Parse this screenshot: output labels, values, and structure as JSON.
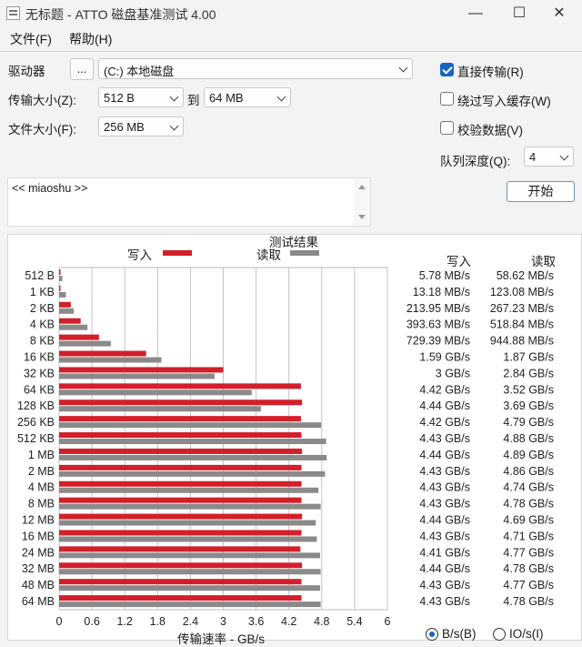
{
  "window": {
    "title": "无标题 - ATTO 磁盘基准测试 4.00",
    "minimize": "—",
    "maximize": "☐",
    "close": "✕"
  },
  "menu": {
    "file": "文件(F)",
    "help": "帮助(H)"
  },
  "drive": {
    "label": "驱动器",
    "browse": "...",
    "value": "(C:) 本地磁盘"
  },
  "transfer_size": {
    "label": "传输大小(Z):",
    "from": "512 B",
    "to_label": "到",
    "to": "64 MB"
  },
  "file_size": {
    "label": "文件大小(F):",
    "value": "256 MB"
  },
  "options": {
    "direct_io": {
      "label": "直接传输(R)",
      "checked": true
    },
    "bypass_cache": {
      "label": "绕过写入缓存(W)",
      "checked": false
    },
    "verify": {
      "label": "校验数据(V)",
      "checked": false
    },
    "queue_depth_label": "队列深度(Q):",
    "queue_depth": "4",
    "start": "开始"
  },
  "description": "<< miaoshu >>",
  "results": {
    "title": "测试结果",
    "legend_write": "写入",
    "legend_read": "读取",
    "col_write": "写入",
    "col_read": "读取",
    "xlabel": "传输速率 - GB/s",
    "units_bs": "B/s(B)",
    "units_ios": "IO/s(I)",
    "units_selected": "B/s(B)",
    "rows": [
      {
        "size": "512 B",
        "write": "5.78 MB/s",
        "read": "58.62 MB/s"
      },
      {
        "size": "1 KB",
        "write": "13.18 MB/s",
        "read": "123.08 MB/s"
      },
      {
        "size": "2 KB",
        "write": "213.95 MB/s",
        "read": "267.23 MB/s"
      },
      {
        "size": "4 KB",
        "write": "393.63 MB/s",
        "read": "518.84 MB/s"
      },
      {
        "size": "8 KB",
        "write": "729.39 MB/s",
        "read": "944.88 MB/s"
      },
      {
        "size": "16 KB",
        "write": "1.59 GB/s",
        "read": "1.87 GB/s"
      },
      {
        "size": "32 KB",
        "write": "3 GB/s",
        "read": "2.84 GB/s"
      },
      {
        "size": "64 KB",
        "write": "4.42 GB/s",
        "read": "3.52 GB/s"
      },
      {
        "size": "128 KB",
        "write": "4.44 GB/s",
        "read": "3.69 GB/s"
      },
      {
        "size": "256 KB",
        "write": "4.42 GB/s",
        "read": "4.79 GB/s"
      },
      {
        "size": "512 KB",
        "write": "4.43 GB/s",
        "read": "4.88 GB/s"
      },
      {
        "size": "1 MB",
        "write": "4.44 GB/s",
        "read": "4.89 GB/s"
      },
      {
        "size": "2 MB",
        "write": "4.43 GB/s",
        "read": "4.86 GB/s"
      },
      {
        "size": "4 MB",
        "write": "4.43 GB/s",
        "read": "4.74 GB/s"
      },
      {
        "size": "8 MB",
        "write": "4.43 GB/s",
        "read": "4.78 GB/s"
      },
      {
        "size": "12 MB",
        "write": "4.44 GB/s",
        "read": "4.69 GB/s"
      },
      {
        "size": "16 MB",
        "write": "4.43 GB/s",
        "read": "4.71 GB/s"
      },
      {
        "size": "24 MB",
        "write": "4.41 GB/s",
        "read": "4.77 GB/s"
      },
      {
        "size": "32 MB",
        "write": "4.44 GB/s",
        "read": "4.78 GB/s"
      },
      {
        "size": "48 MB",
        "write": "4.43 GB/s",
        "read": "4.77 GB/s"
      },
      {
        "size": "64 MB",
        "write": "4.43 GB/s",
        "read": "4.78 GB/s"
      }
    ]
  },
  "colors": {
    "write": "#d21f2a",
    "read": "#8a8a8a",
    "accent": "#1565c0"
  },
  "chart_data": {
    "type": "bar",
    "orientation": "horizontal",
    "title": "测试结果",
    "xlabel": "传输速率 - GB/s",
    "xlim": [
      0,
      6
    ],
    "xticks": [
      "0",
      "0.6",
      "1.2",
      "1.8",
      "2.4",
      "3",
      "3.6",
      "4.2",
      "4.8",
      "5.4",
      "6"
    ],
    "grid": true,
    "legend_placement": "top",
    "categories": [
      "512 B",
      "1 KB",
      "2 KB",
      "4 KB",
      "8 KB",
      "16 KB",
      "32 KB",
      "64 KB",
      "128 KB",
      "256 KB",
      "512 KB",
      "1 MB",
      "2 MB",
      "4 MB",
      "8 MB",
      "12 MB",
      "16 MB",
      "24 MB",
      "32 MB",
      "48 MB",
      "64 MB"
    ],
    "series": [
      {
        "name": "写入",
        "values": [
          0.00578,
          0.01318,
          0.21395,
          0.39363,
          0.72939,
          1.59,
          3.0,
          4.42,
          4.44,
          4.42,
          4.43,
          4.44,
          4.43,
          4.43,
          4.43,
          4.44,
          4.43,
          4.41,
          4.44,
          4.43,
          4.43
        ]
      },
      {
        "name": "读取",
        "values": [
          0.05862,
          0.12308,
          0.26723,
          0.51884,
          0.94488,
          1.87,
          2.84,
          3.52,
          3.69,
          4.79,
          4.88,
          4.89,
          4.86,
          4.74,
          4.78,
          4.69,
          4.71,
          4.77,
          4.78,
          4.77,
          4.78
        ]
      }
    ]
  }
}
